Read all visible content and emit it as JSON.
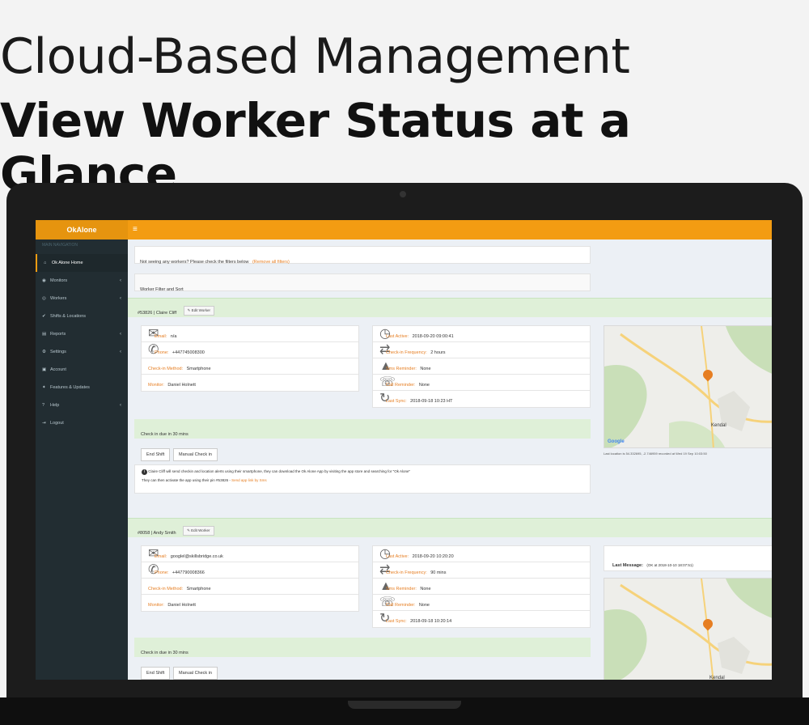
{
  "headline": {
    "line1": "Cloud-Based Management",
    "line2": "View Worker Status at a Glance"
  },
  "app": {
    "brand": "OkAlone",
    "menu_icon": "hamburger-icon",
    "sidebar_subtitle": "MAIN NAVIGATION"
  },
  "sidebar": {
    "items": [
      {
        "label": "Ok Alone Home",
        "icon": "home-icon",
        "active": true
      },
      {
        "label": "Monitors",
        "icon": "user-icon",
        "caret": true
      },
      {
        "label": "Workers",
        "icon": "group-icon",
        "caret": true
      },
      {
        "label": "Shifts & Locations",
        "icon": "check-icon"
      },
      {
        "label": "Reports",
        "icon": "chart-icon",
        "caret": true
      },
      {
        "label": "Settings",
        "icon": "gear-icon",
        "caret": true
      },
      {
        "label": "Account",
        "icon": "account-icon"
      },
      {
        "label": "Features & Updates",
        "icon": "star-icon"
      },
      {
        "label": "Help",
        "icon": "help-icon",
        "caret": true
      },
      {
        "label": "Logout",
        "icon": "logout-icon"
      }
    ]
  },
  "main": {
    "notice": "Not seeing any workers? Please check the filters below",
    "notice_link": "(Remove all filters)",
    "filter_label": "Worker Filter and Sort",
    "edit_label": "Edit Worker",
    "workers": [
      {
        "header": "#53826 | Claire Cliff",
        "left": [
          {
            "label": "Email:",
            "value": "n/a"
          },
          {
            "label": "Phone:",
            "value": "+447745008300"
          },
          {
            "label": "Check-in Method:",
            "value": "Smartphone"
          },
          {
            "label": "Monitor:",
            "value": "Daniel Holnett"
          }
        ],
        "right": [
          {
            "label": "Last Active:",
            "value": "2018-09-20 09:00:41"
          },
          {
            "label": "Check-in Frequency:",
            "value": "2 hours"
          },
          {
            "label": "Sms Reminder:",
            "value": "None"
          },
          {
            "label": "Call Reminder:",
            "value": "None"
          },
          {
            "label": "Last Sync:",
            "value": "2018-09-18 10:23 HT"
          }
        ],
        "checkin_due": "Check in due in 30 mins",
        "end_shift": "End Shift",
        "manual_checkin": "Manual Check in",
        "info": "Claire Cliff will send checkin and location alerts using their smartphone, they can download the Ok Alone App by visiting the app store and searching for \"Ok Alone\"",
        "info2": "They can then activate the app using their pin #53826 -",
        "info_link": "Send app link by Sms",
        "map_caption": "Last location is 54.332695, -2.746959 recorded at Wed 19 Sep 10:03:50"
      },
      {
        "header": "#8058 | Andy Smith",
        "left": [
          {
            "label": "Email:",
            "value": "googlel@skillsbridge.co.uk"
          },
          {
            "label": "Phone:",
            "value": "+447790008366"
          },
          {
            "label": "Check-in Method:",
            "value": "Smartphone"
          },
          {
            "label": "Monitor:",
            "value": "Daniel Holnett"
          }
        ],
        "right": [
          {
            "label": "Last Active:",
            "value": "2018-09-20 10:20:20"
          },
          {
            "label": "Check-in Frequency:",
            "value": "90 mins"
          },
          {
            "label": "Sms Reminder:",
            "value": "None"
          },
          {
            "label": "Call Reminder:",
            "value": "None"
          },
          {
            "label": "Last Sync:",
            "value": "2018-09-18 10:20:14"
          }
        ],
        "checkin_due": "Check in due in 30 mins",
        "end_shift": "End Shift",
        "manual_checkin": "Manual Check in",
        "last_message": "Last Message:",
        "last_message_value": "(OK at 2018-10-10 18:07:51)"
      }
    ],
    "map_town": "Kendal",
    "map_logo": "Google"
  }
}
